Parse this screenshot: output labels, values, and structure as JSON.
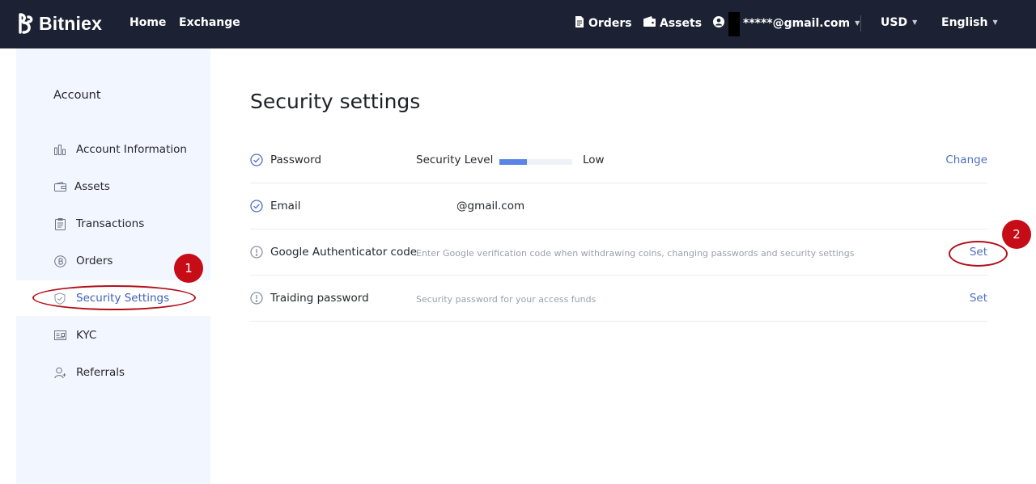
{
  "header": {
    "brand": "Bitniex",
    "nav": {
      "home": "Home",
      "exchange": "Exchange"
    },
    "orders": "Orders",
    "assets": "Assets",
    "account_email": "*****@gmail.com",
    "currency": "USD",
    "language": "English"
  },
  "sidebar": {
    "title": "Account",
    "items": [
      {
        "label": "Account Information",
        "icon": "bar-chart-icon"
      },
      {
        "label": "Assets",
        "icon": "wallet-icon"
      },
      {
        "label": "Transactions",
        "icon": "clipboard-icon"
      },
      {
        "label": "Orders",
        "icon": "coin-icon"
      },
      {
        "label": "Security Settings",
        "icon": "shield-icon",
        "active": true
      },
      {
        "label": "KYC",
        "icon": "id-card-icon"
      },
      {
        "label": "Referrals",
        "icon": "user-plus-icon"
      }
    ]
  },
  "main": {
    "title": "Security settings",
    "rows": [
      {
        "label": "Password",
        "status": "verified",
        "security_level_label": "Security Level",
        "security_level_value": "Low",
        "security_level_fraction": 0.38,
        "action": "Change"
      },
      {
        "label": "Email",
        "status": "verified",
        "value": "@gmail.com"
      },
      {
        "label": "Google Authenticator code",
        "status": "warning",
        "description": "Enter Google verification code when withdrawing coins, changing passwords and security settings",
        "action": "Set"
      },
      {
        "label": "Traiding password",
        "status": "warning",
        "description": "Security password for your access funds",
        "action": "Set"
      }
    ]
  },
  "annotations": {
    "badge1": "1",
    "badge2": "2"
  },
  "colors": {
    "topbar": "#1c2233",
    "sidebar_bg": "#f1f6ff",
    "accent": "#4d6fc0",
    "level_fill": "#5a85e6",
    "annotation_red": "#c60c16"
  }
}
